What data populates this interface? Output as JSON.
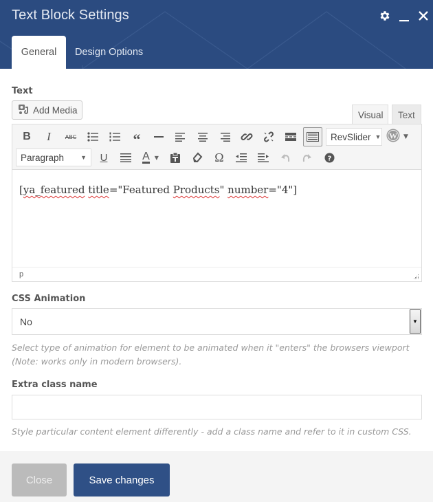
{
  "header": {
    "title": "Text Block Settings",
    "icons": [
      "gear-icon",
      "minimize-icon",
      "close-icon"
    ],
    "tabs": [
      {
        "label": "General",
        "active": true
      },
      {
        "label": "Design Options",
        "active": false
      }
    ],
    "background_color": "#2b4b80"
  },
  "text_field": {
    "label": "Text",
    "add_media_label": "Add Media",
    "mode_tabs": [
      {
        "label": "Visual",
        "active": true
      },
      {
        "label": "Text",
        "active": false
      }
    ],
    "toolbar": {
      "row1": [
        "bold",
        "italic",
        "strikethrough",
        "bulleted-list",
        "numbered-list",
        "blockquote",
        "horizontal-line",
        "align-left",
        "align-center",
        "align-right",
        "insert-link",
        "remove-link",
        "read-more",
        "toolbar-toggle"
      ],
      "revslider_label": "RevSlider",
      "format_select": "Paragraph",
      "row2": [
        "underline",
        "justify",
        "text-color",
        "paste-as-text",
        "clear-formatting",
        "special-character",
        "outdent",
        "indent",
        "undo",
        "redo",
        "keyboard-shortcuts"
      ]
    },
    "content": {
      "open": "[",
      "w1": "ya_featured",
      "t1": " ",
      "w2": "title",
      "t2": "=\"Featured ",
      "w3": "Products",
      "t3": "\" ",
      "w4": "number",
      "t4": "=\"4\"]"
    },
    "status_path": "p"
  },
  "css_animation": {
    "label": "CSS Animation",
    "selected": "No",
    "help": "Select type of animation for element to be animated when it \"enters\" the browsers viewport (Note: works only in modern browsers)."
  },
  "extra_class": {
    "label": "Extra class name",
    "value": "",
    "placeholder": "",
    "help": "Style particular content element differently - add a class name and refer to it in custom CSS."
  },
  "footer": {
    "close_label": "Close",
    "save_label": "Save changes",
    "save_color": "#2f5086"
  }
}
